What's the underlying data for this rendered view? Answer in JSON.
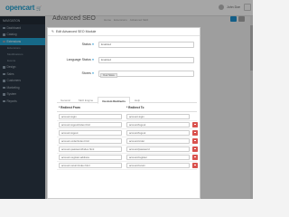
{
  "header": {
    "logo_text": "opencart",
    "user_name": "John Doe"
  },
  "sidebar": {
    "heading": "NAVIGATION",
    "items": [
      {
        "label": "Dashboard",
        "active": false
      },
      {
        "label": "Catalog",
        "active": false
      },
      {
        "label": "Extensions",
        "active": true
      },
      {
        "label": "Extensions",
        "sub": true
      },
      {
        "label": "Modifications",
        "sub": true
      },
      {
        "label": "Events",
        "sub": true
      },
      {
        "label": "Design",
        "active": false
      },
      {
        "label": "Sales",
        "active": false
      },
      {
        "label": "Customers",
        "active": false
      },
      {
        "label": "Marketing",
        "active": false
      },
      {
        "label": "System",
        "active": false
      },
      {
        "label": "Reports",
        "active": false
      }
    ]
  },
  "page": {
    "title": "Advanced SEO",
    "breadcrumb": [
      "Home",
      "Extensions",
      "Advanced SEO"
    ]
  },
  "modal": {
    "heading": "Edit Advanced SEO Module",
    "fields": [
      {
        "label": "Status",
        "value": "Enabled"
      },
      {
        "label": "Language Status",
        "value": "Enabled"
      },
      {
        "label": "Stores",
        "value": "Your Store"
      }
    ],
    "tabs": [
      "General",
      "SEO Engine",
      "Custom Redirects",
      "Help"
    ],
    "active_tab": "Custom Redirects",
    "table": {
      "col_from": "Redirect From",
      "col_to": "Redirect To",
      "rows": [
        {
          "from": "account-login",
          "to": "account-login"
        },
        {
          "from": "account-logout/index.html",
          "to": "account/logout"
        },
        {
          "from": "account-logout",
          "to": "account/logout"
        },
        {
          "from": "account-order/index.html",
          "to": "account/order"
        },
        {
          "from": "account-password/index.html",
          "to": "account/password"
        },
        {
          "from": "account-register-address",
          "to": "account/register"
        },
        {
          "from": "account-return/index.html",
          "to": "account/return"
        }
      ]
    }
  },
  "colors": {
    "accent": "#23a1d1",
    "sidebar_bg": "#2b3845",
    "danger": "#d9534f"
  }
}
